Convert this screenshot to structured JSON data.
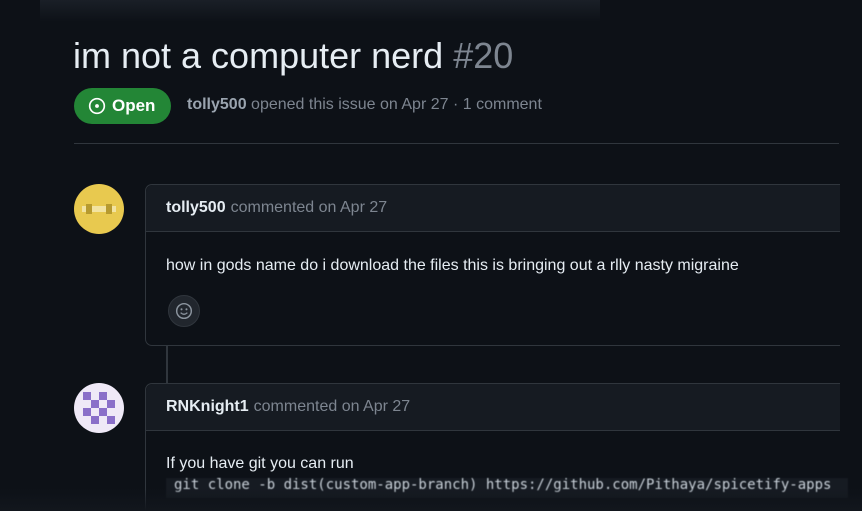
{
  "issue": {
    "title": "im not a computer nerd",
    "number": "#20",
    "state": "Open",
    "author": "tolly500",
    "meta_text": "opened this issue on Apr 27 · 1 comment"
  },
  "comments": [
    {
      "author": "tolly500",
      "action": "commented on Apr 27",
      "body": "how in gods name do i download the files this is bringing out a rlly nasty migraine"
    },
    {
      "author": "RNKnight1",
      "action": "commented on Apr 27",
      "body": "If you have git you can run",
      "code": "git clone -b dist(custom-app-branch) https://github.com/Pithaya/spicetify-apps"
    }
  ],
  "icons": {
    "state": "issue-opened-icon",
    "reaction": "smiley-icon"
  },
  "colors": {
    "background": "#0d1117",
    "badge_green": "#238636",
    "border": "#30363d",
    "muted_text": "#7d8590"
  }
}
